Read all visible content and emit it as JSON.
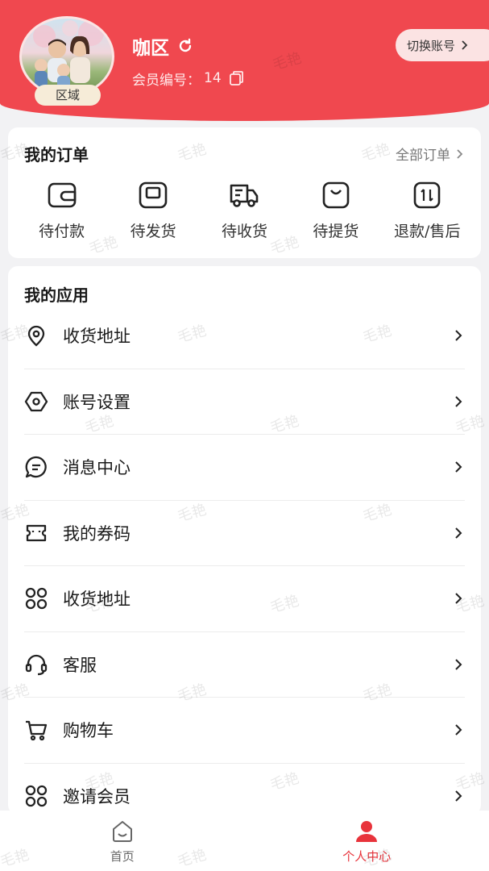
{
  "header": {
    "username": "咖区",
    "member_label": "会员编号：",
    "member_no": "14",
    "region_badge": "区域",
    "switch_account": "切换账号",
    "brand_color": "#f0484f"
  },
  "orders": {
    "title": "我的订单",
    "all_link": "全部订单",
    "items": [
      {
        "label": "待付款",
        "icon": "wallet-icon"
      },
      {
        "label": "待发货",
        "icon": "package-icon"
      },
      {
        "label": "待收货",
        "icon": "truck-icon"
      },
      {
        "label": "待提货",
        "icon": "bag-icon"
      },
      {
        "label": "退款/售后",
        "icon": "refund-icon"
      }
    ]
  },
  "apps": {
    "title": "我的应用",
    "items": [
      {
        "label": "收货地址",
        "icon": "location-pin-icon"
      },
      {
        "label": "账号设置",
        "icon": "settings-hexagon-icon"
      },
      {
        "label": "消息中心",
        "icon": "message-icon"
      },
      {
        "label": "我的券码",
        "icon": "ticket-icon"
      },
      {
        "label": "收货地址",
        "icon": "grid-icon"
      },
      {
        "label": "客服",
        "icon": "headset-icon"
      },
      {
        "label": "购物车",
        "icon": "cart-icon"
      },
      {
        "label": "邀请会员",
        "icon": "grid-icon"
      }
    ]
  },
  "tabbar": {
    "items": [
      {
        "label": "首页",
        "icon": "home-icon",
        "active": false
      },
      {
        "label": "个人中心",
        "icon": "user-icon",
        "active": true
      }
    ],
    "active_color": "#e8333b",
    "inactive_color": "#666666"
  },
  "watermark": "毛艳"
}
